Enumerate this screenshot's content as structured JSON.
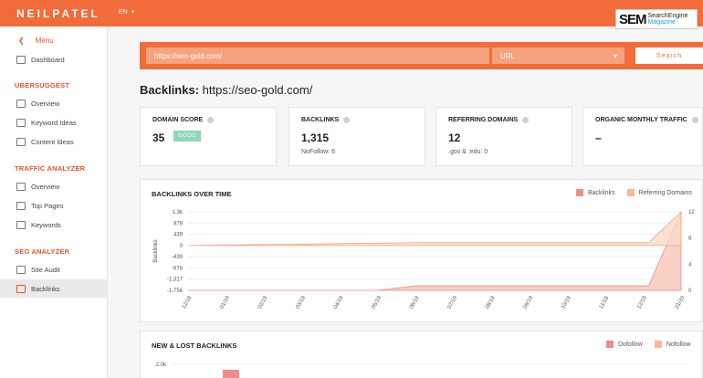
{
  "header": {
    "logo": "NEILPATEL",
    "lang": "EN",
    "lang_icon": "chevron-down-icon"
  },
  "badge": {
    "sem": "SEM",
    "line1": "SearchEngine",
    "line2": "Magazine"
  },
  "sidebar": {
    "menu_label": "Menu",
    "dashboard": "Dashboard",
    "sections": [
      {
        "title": "UBERSUGGEST",
        "items": [
          "Overview",
          "Keyword Ideas",
          "Content Ideas"
        ]
      },
      {
        "title": "TRAFFIC ANALYZER",
        "items": [
          "Overview",
          "Top Pages",
          "Keywords"
        ]
      },
      {
        "title": "SEO ANALYZER",
        "items": [
          "Site Audit",
          "Backlinks"
        ]
      }
    ],
    "active_item": "Backlinks"
  },
  "search": {
    "value": "https://seo-gold.com/",
    "type": "URL",
    "button": "Search"
  },
  "page_title": {
    "prefix": "Backlinks:",
    "url": "https://seo-gold.com/"
  },
  "cards": [
    {
      "title": "DOMAIN SCORE",
      "value": "35",
      "badge": "GOOD",
      "sub": ""
    },
    {
      "title": "BACKLINKS",
      "value": "1,315",
      "sub": "NoFollow: 6"
    },
    {
      "title": "REFERRING DOMAINS",
      "value": "12",
      "sub": ".gov & .edu: 0"
    },
    {
      "title": "ORGANIC MONTHLY TRAFFIC",
      "value": "–",
      "sub": ""
    }
  ],
  "colors": {
    "brand": "#f26b3a",
    "backlinks": "#f08c8c",
    "referring": "#f7b99a",
    "good": "#8ed6b5"
  },
  "chart_data": [
    {
      "type": "area",
      "title": "BACKLINKS OVER TIME",
      "ylabel": "Backlinks",
      "legend": [
        "Backlinks",
        "Referring Domains"
      ],
      "legend_position": "top-right",
      "y_ticks_left": [
        "1.3k",
        "878",
        "439",
        "0",
        "-439",
        "-878",
        "-1,317",
        "-1,756"
      ],
      "y_ticks_right": [
        "12",
        "8",
        "4",
        "0"
      ],
      "x_ticks": [
        "12/18",
        "01/19",
        "02/19",
        "03/19",
        "04/19",
        "05/19",
        "06/19",
        "07/19",
        "08/19",
        "09/19",
        "10/19",
        "11/19",
        "12/19",
        "01/20"
      ],
      "series": [
        {
          "name": "Backlinks",
          "x": [
            "12/18",
            "05/19",
            "06/19",
            "12/19",
            "01/20"
          ],
          "values": [
            -1756,
            -1756,
            -1580,
            -1580,
            1315
          ]
        },
        {
          "name": "Referring Domains",
          "x": [
            "12/18",
            "06/19",
            "12/19",
            "01/20"
          ],
          "values": [
            0,
            1,
            1,
            12
          ]
        }
      ]
    },
    {
      "type": "bar",
      "title": "NEW & LOST BACKLINKS",
      "legend": [
        "Dofollow",
        "Nofollow"
      ],
      "legend_position": "top-right",
      "y_ticks_left": [
        "2.0k"
      ]
    }
  ]
}
